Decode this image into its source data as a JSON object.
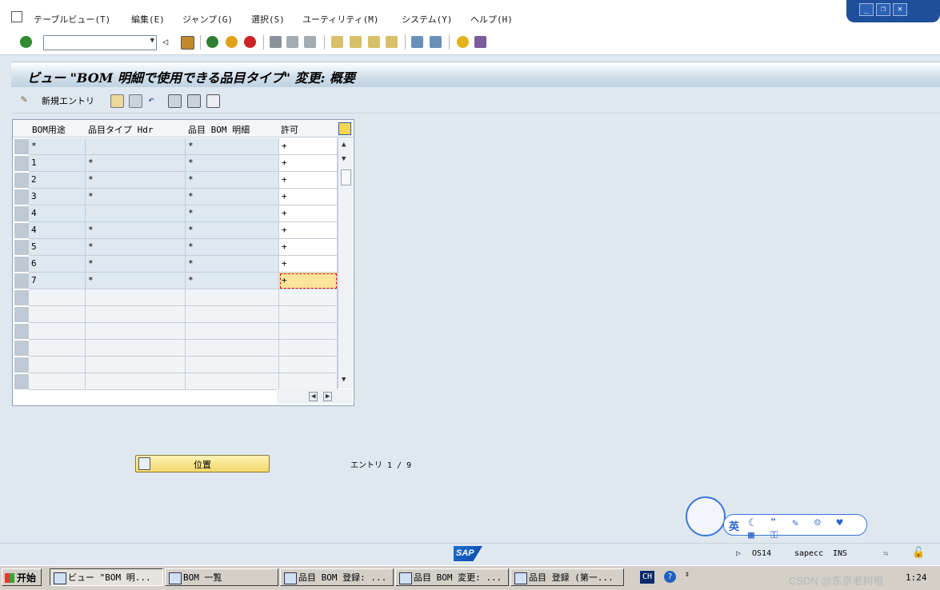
{
  "menu": {
    "items": [
      "テーブルビュー(T)",
      "編集(E)",
      "ジャンプ(G)",
      "選択(S)",
      "ユーティリティ(M)",
      "システム(Y)",
      "ヘルプ(H)"
    ]
  },
  "title": "ビュー \"BOM 明細で使用できる品目タイプ\" 変更: 概要",
  "app_toolbar": {
    "new_entry": "新規エントリ"
  },
  "table": {
    "headers": [
      "BOM用途",
      "品目タイプ Hdr",
      "品目 BOM 明細",
      "許可"
    ],
    "rows": [
      [
        "*",
        "",
        "*",
        "+"
      ],
      [
        "1",
        "*",
        "*",
        "+"
      ],
      [
        "2",
        "*",
        "*",
        "+"
      ],
      [
        "3",
        "*",
        "*",
        "+"
      ],
      [
        "4",
        "",
        "*",
        "+"
      ],
      [
        "4",
        "*",
        "*",
        "+"
      ],
      [
        "5",
        "*",
        "*",
        "+"
      ],
      [
        "6",
        "*",
        "*",
        "+"
      ],
      [
        "7",
        "*",
        "*",
        "+"
      ]
    ]
  },
  "position_button": "位置",
  "entry_count": "エントリ 1 / 9",
  "ime": {
    "label": "英"
  },
  "status": {
    "sap_logo": "SAP",
    "system": "OS14",
    "server": "sapecc",
    "mode": "INS"
  },
  "taskbar": {
    "start": "开始",
    "tasks": [
      "ビュー \"BOM 明...",
      "BOM 一覧",
      "品目 BOM 登録: ...",
      "品目 BOM 変更: ...",
      "品目 登録 (第一..."
    ],
    "lang": "CH",
    "watermark": "CSDN @东京老树根",
    "clock": "1:24"
  }
}
